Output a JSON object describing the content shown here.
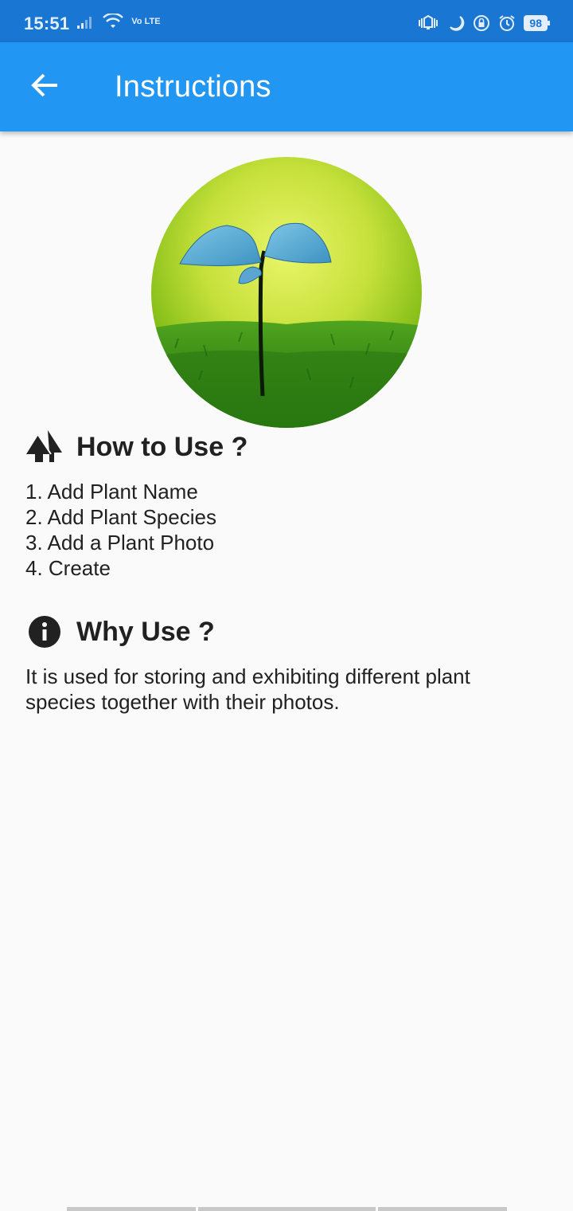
{
  "status_bar": {
    "time": "15:51",
    "network_badge": "Vo LTE",
    "battery": "98",
    "icons": [
      "signal-icon",
      "wifi-icon",
      "vibrate-icon",
      "moon-icon",
      "rotation-lock-icon",
      "alarm-icon",
      "battery-icon"
    ]
  },
  "app_bar": {
    "title": "Instructions",
    "back_icon": "arrow-back-icon",
    "color": "#2196f3",
    "status_color": "#1976d2"
  },
  "hero": {
    "description": "plant-seedling-image"
  },
  "how_to_use": {
    "icon": "trees-icon",
    "title": "How to Use ?",
    "steps": [
      "1. Add Plant Name",
      "2. Add Plant Species",
      "3. Add a Plant Photo",
      "4. Create"
    ]
  },
  "why_use": {
    "icon": "info-icon",
    "title": "Why Use ?",
    "text": "It is used for storing and exhibiting different plant species together with their photos."
  }
}
